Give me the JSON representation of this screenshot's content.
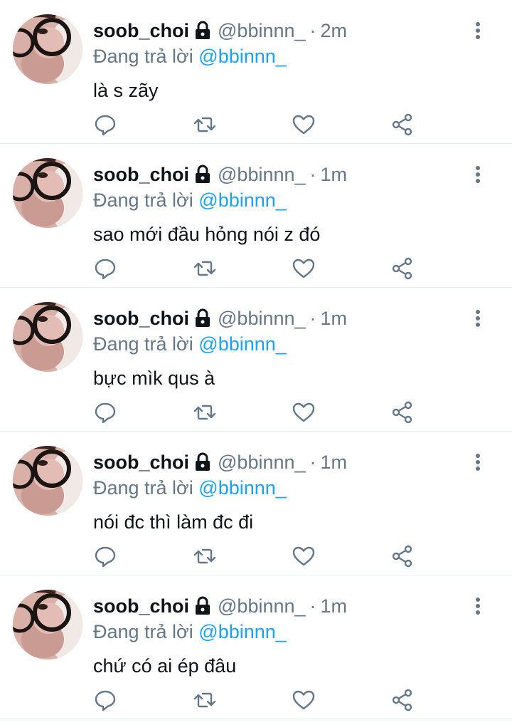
{
  "tweets": [
    {
      "name": "soob_choi",
      "handle": "@bbinnn_",
      "separator": "·",
      "time": "2m",
      "reply_prefix": "Đang trả lời",
      "reply_target": "@bbinnn_",
      "text": "là s zãy"
    },
    {
      "name": "soob_choi",
      "handle": "@bbinnn_",
      "separator": "·",
      "time": "1m",
      "reply_prefix": "Đang trả lời",
      "reply_target": "@bbinnn_",
      "text": "sao mới đầu hỏng nói z đó"
    },
    {
      "name": "soob_choi",
      "handle": "@bbinnn_",
      "separator": "·",
      "time": "1m",
      "reply_prefix": "Đang trả lời",
      "reply_target": "@bbinnn_",
      "text": "bực mìk qus à"
    },
    {
      "name": "soob_choi",
      "handle": "@bbinnn_",
      "separator": "·",
      "time": "1m",
      "reply_prefix": "Đang trả lời",
      "reply_target": "@bbinnn_",
      "text": "nói đc thì làm đc đi"
    },
    {
      "name": "soob_choi",
      "handle": "@bbinnn_",
      "separator": "·",
      "time": "1m",
      "reply_prefix": "Đang trả lời",
      "reply_target": "@bbinnn_",
      "text": "chứ có ai ép đâu"
    }
  ],
  "icons": {
    "lock": "lock-icon",
    "more": "more-vertical-icon",
    "reply": "reply-icon",
    "retweet": "retweet-icon",
    "like": "heart-icon",
    "share": "share-icon"
  },
  "colors": {
    "text": "#0f1419",
    "secondary": "#657786",
    "accent": "#1da1f2",
    "divider": "#e6ecf0"
  }
}
